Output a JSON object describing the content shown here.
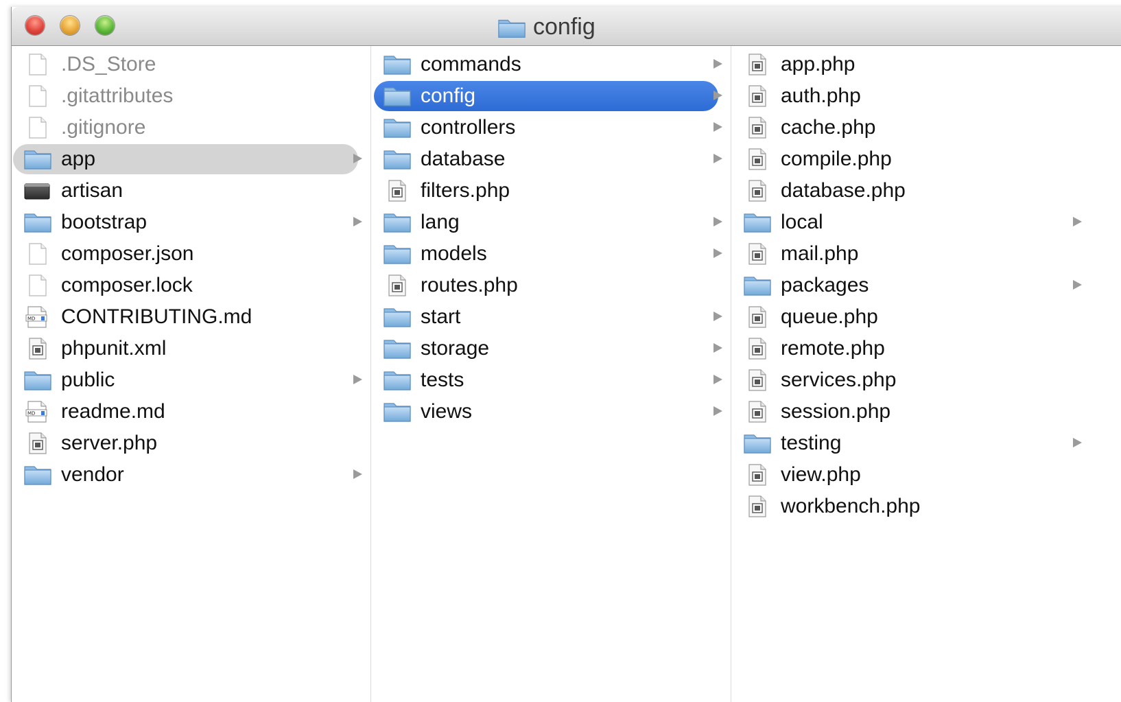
{
  "window": {
    "title": "config",
    "title_icon": "folder-icon"
  },
  "columns": [
    {
      "name": "root",
      "items": [
        {
          "label": ".DS_Store",
          "icon": "blank-doc-icon",
          "type": "file",
          "dim": true
        },
        {
          "label": ".gitattributes",
          "icon": "blank-doc-icon",
          "type": "file",
          "dim": true
        },
        {
          "label": ".gitignore",
          "icon": "blank-doc-icon",
          "type": "file",
          "dim": true
        },
        {
          "label": "app",
          "icon": "folder-icon",
          "type": "folder",
          "selected": "inactive"
        },
        {
          "label": "artisan",
          "icon": "terminal-icon",
          "type": "file"
        },
        {
          "label": "bootstrap",
          "icon": "folder-icon",
          "type": "folder"
        },
        {
          "label": "composer.json",
          "icon": "blank-doc-icon",
          "type": "file"
        },
        {
          "label": "composer.lock",
          "icon": "blank-doc-icon",
          "type": "file"
        },
        {
          "label": "CONTRIBUTING.md",
          "icon": "markdown-doc-icon",
          "type": "file"
        },
        {
          "label": "phpunit.xml",
          "icon": "script-doc-icon",
          "type": "file"
        },
        {
          "label": "public",
          "icon": "folder-icon",
          "type": "folder"
        },
        {
          "label": "readme.md",
          "icon": "markdown-doc-icon",
          "type": "file"
        },
        {
          "label": "server.php",
          "icon": "script-doc-icon",
          "type": "file"
        },
        {
          "label": "vendor",
          "icon": "folder-icon",
          "type": "folder"
        }
      ]
    },
    {
      "name": "app",
      "items": [
        {
          "label": "commands",
          "icon": "folder-icon",
          "type": "folder"
        },
        {
          "label": "config",
          "icon": "folder-icon",
          "type": "folder",
          "selected": "active"
        },
        {
          "label": "controllers",
          "icon": "folder-icon",
          "type": "folder"
        },
        {
          "label": "database",
          "icon": "folder-icon",
          "type": "folder"
        },
        {
          "label": "filters.php",
          "icon": "script-doc-icon",
          "type": "file"
        },
        {
          "label": "lang",
          "icon": "folder-icon",
          "type": "folder"
        },
        {
          "label": "models",
          "icon": "folder-icon",
          "type": "folder"
        },
        {
          "label": "routes.php",
          "icon": "script-doc-icon",
          "type": "file"
        },
        {
          "label": "start",
          "icon": "folder-icon",
          "type": "folder"
        },
        {
          "label": "storage",
          "icon": "folder-icon",
          "type": "folder"
        },
        {
          "label": "tests",
          "icon": "folder-icon",
          "type": "folder"
        },
        {
          "label": "views",
          "icon": "folder-icon",
          "type": "folder"
        }
      ]
    },
    {
      "name": "config",
      "items": [
        {
          "label": "app.php",
          "icon": "script-doc-icon",
          "type": "file"
        },
        {
          "label": "auth.php",
          "icon": "script-doc-icon",
          "type": "file"
        },
        {
          "label": "cache.php",
          "icon": "script-doc-icon",
          "type": "file"
        },
        {
          "label": "compile.php",
          "icon": "script-doc-icon",
          "type": "file"
        },
        {
          "label": "database.php",
          "icon": "script-doc-icon",
          "type": "file"
        },
        {
          "label": "local",
          "icon": "folder-icon",
          "type": "folder"
        },
        {
          "label": "mail.php",
          "icon": "script-doc-icon",
          "type": "file"
        },
        {
          "label": "packages",
          "icon": "folder-icon",
          "type": "folder"
        },
        {
          "label": "queue.php",
          "icon": "script-doc-icon",
          "type": "file"
        },
        {
          "label": "remote.php",
          "icon": "script-doc-icon",
          "type": "file"
        },
        {
          "label": "services.php",
          "icon": "script-doc-icon",
          "type": "file"
        },
        {
          "label": "session.php",
          "icon": "script-doc-icon",
          "type": "file"
        },
        {
          "label": "testing",
          "icon": "folder-icon",
          "type": "folder"
        },
        {
          "label": "view.php",
          "icon": "script-doc-icon",
          "type": "file"
        },
        {
          "label": "workbench.php",
          "icon": "script-doc-icon",
          "type": "file"
        }
      ]
    }
  ],
  "colors": {
    "selection_active": "#3a78de",
    "selection_inactive": "#d4d4d4",
    "folder": "#7fb2e0"
  }
}
